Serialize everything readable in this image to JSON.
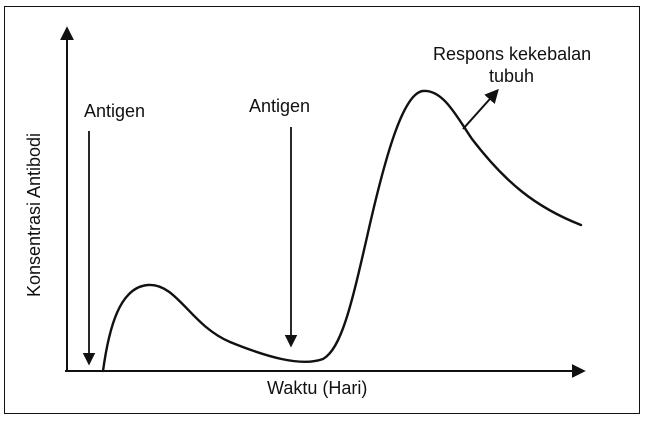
{
  "chart_data": {
    "type": "line",
    "xlabel": "Waktu (Hari)",
    "ylabel": "Konsentrasi Antibodi",
    "annotations": {
      "antigen_first": "Antigen",
      "antigen_second": "Antigen",
      "response_line1": "Respons kekebalan",
      "response_line2": "tubuh"
    },
    "grid": false,
    "legend": "none",
    "colors": {
      "ink": "#111111",
      "background": "#ffffff"
    }
  }
}
